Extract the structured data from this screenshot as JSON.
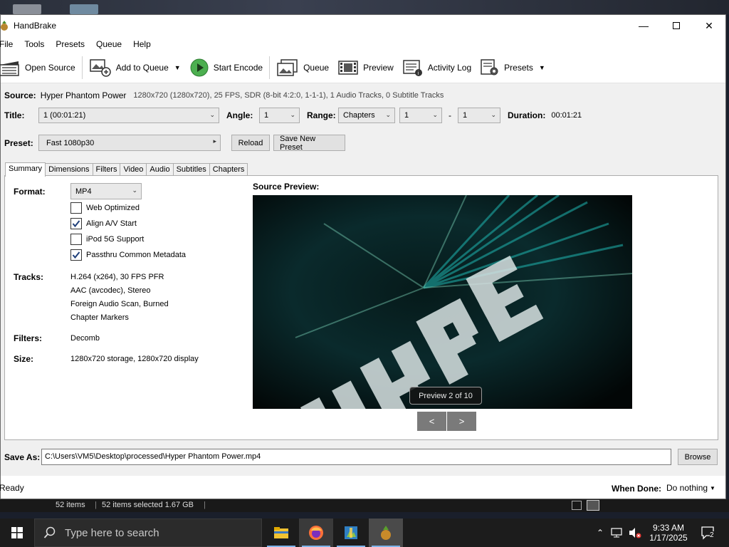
{
  "window": {
    "title": "HandBrake"
  },
  "menu": [
    "File",
    "Tools",
    "Presets",
    "Queue",
    "Help"
  ],
  "toolbar": {
    "open_source": "Open Source",
    "add_to_queue": "Add to Queue",
    "start_encode": "Start Encode",
    "queue": "Queue",
    "preview": "Preview",
    "activity_log": "Activity Log",
    "presets": "Presets"
  },
  "source": {
    "label": "Source:",
    "name": "Hyper Phantom Power",
    "info": "1280x720 (1280x720), 25 FPS, SDR (8-bit 4:2:0, 1-1-1), 1 Audio Tracks, 0 Subtitle Tracks"
  },
  "title_row": {
    "title_label": "Title:",
    "title_value": "1  (00:01:21)",
    "angle_label": "Angle:",
    "angle_value": "1",
    "range_label": "Range:",
    "range_value": "Chapters",
    "range_start": "1",
    "range_sep": "-",
    "range_end": "1",
    "duration_label": "Duration:",
    "duration_value": "00:01:21"
  },
  "preset_row": {
    "label": "Preset:",
    "value": "Fast 1080p30",
    "reload": "Reload",
    "save_new": "Save New Preset"
  },
  "tabs": [
    "Summary",
    "Dimensions",
    "Filters",
    "Video",
    "Audio",
    "Subtitles",
    "Chapters"
  ],
  "summary": {
    "format_label": "Format:",
    "format_value": "MP4",
    "options": [
      {
        "label": "Web Optimized",
        "checked": false
      },
      {
        "label": "Align A/V Start",
        "checked": true
      },
      {
        "label": "iPod 5G Support",
        "checked": false
      },
      {
        "label": "Passthru Common Metadata",
        "checked": true
      }
    ],
    "tracks_label": "Tracks:",
    "tracks": [
      "H.264 (x264), 30 FPS PFR",
      "AAC (avcodec), Stereo",
      "Foreign Audio Scan, Burned",
      "Chapter Markers"
    ],
    "filters_label": "Filters:",
    "filters_value": "Decomb",
    "size_label": "Size:",
    "size_value": "1280x720 storage, 1280x720 display",
    "source_preview_label": "Source Preview:",
    "preview_badge": "Preview 2 of 10",
    "prev": "<",
    "next": ">"
  },
  "save_as": {
    "label": "Save As:",
    "path": "C:\\Users\\VM5\\Desktop\\processed\\Hyper Phantom Power.mp4",
    "browse": "Browse"
  },
  "status": {
    "text": "Ready",
    "when_done_label": "When Done:",
    "when_done_value": "Do nothing"
  },
  "explorer": {
    "items": "52 items",
    "selected": "52 items selected  1.67 GB"
  },
  "taskbar": {
    "search_placeholder": "Type here to search",
    "time": "9:33 AM",
    "date": "1/17/2025",
    "notifications": "2"
  },
  "colors": {
    "accent_green": "#4caf50",
    "preview_cyan": "#1fb5b0"
  }
}
